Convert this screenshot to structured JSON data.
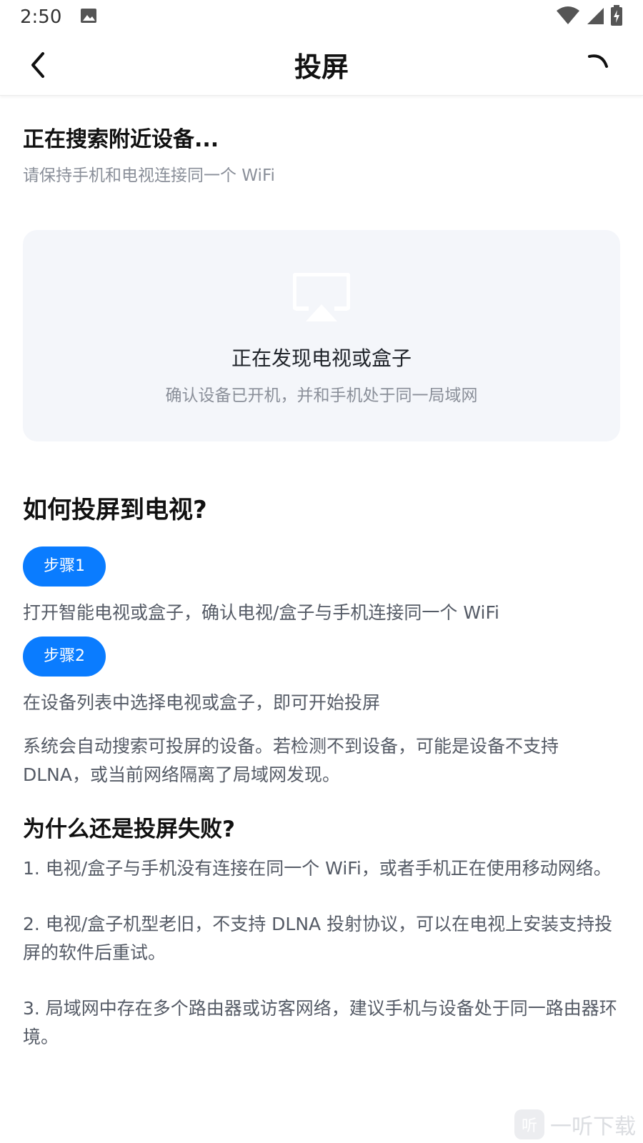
{
  "status_bar": {
    "time": "2:50",
    "icons": [
      "image-icon",
      "wifi-icon",
      "signal-icon",
      "battery-icon"
    ]
  },
  "header": {
    "title": "投屏",
    "back_icon": "chevron-left-icon",
    "right_icon": "loading-spinner-icon"
  },
  "search": {
    "title": "正在搜索附近设备...",
    "subtitle": "请保持手机和电视连接同一个 WiFi"
  },
  "discover_card": {
    "icon": "airplay-cast-icon",
    "title": "正在发现电视或盒子",
    "hint": "确认设备已开机，并和手机处于同一局域网"
  },
  "howto": {
    "title": "如何投屏到电视?",
    "steps": [
      {
        "badge": "步骤1",
        "text": "打开智能电视或盒子，确认电视/盒子与手机连接同一个 WiFi"
      },
      {
        "badge": "步骤2",
        "text": "在设备列表中选择电视或盒子，即可开始投屏"
      }
    ],
    "note": "系统会自动搜索可投屏的设备。若检测不到设备，可能是设备不支持 DLNA，或当前网络隔离了局域网发现。"
  },
  "failure": {
    "title": "为什么还是投屏失败?",
    "items": [
      "1. 电视/盒子与手机没有连接在同一个 WiFi，或者手机正在使用移动网络。",
      "2. 电视/盒子机型老旧，不支持 DLNA 投射协议，可以在电视上安装支持投屏的软件后重试。",
      "3. 局域网中存在多个路由器或访客网络，建议手机与设备处于同一路由器环境。"
    ]
  },
  "watermark": {
    "logo_text": "听",
    "text": "一听下载"
  },
  "colors": {
    "accent": "#0a7cff",
    "card_bg": "#f4f6fa",
    "muted_text": "#8a8f99"
  }
}
